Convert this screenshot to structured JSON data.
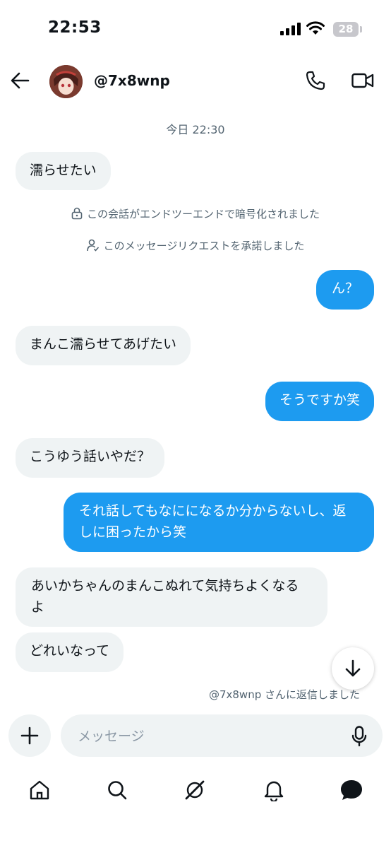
{
  "status_bar": {
    "time": "22:53",
    "battery": "28"
  },
  "header": {
    "username": "@7x8wnp",
    "back_icon": "arrow-left-icon",
    "call_icon": "phone-icon",
    "video_icon": "video-icon"
  },
  "chat": {
    "timestamp": "今日 22:30",
    "first_message": "濡らせたい",
    "encryption_notice": "この会話がエンドツーエンドで暗号化されました",
    "request_notice": "このメッセージリクエストを承諾しました",
    "messages": [
      {
        "side": "out",
        "text": "ん？"
      },
      {
        "side": "in",
        "text": "まんこ濡らせてあげたい"
      },
      {
        "side": "out",
        "text": "そうですか笑"
      },
      {
        "side": "in",
        "text": "こうゆう話いやだ？"
      },
      {
        "side": "out",
        "text": "それ話してもなにになるか分からないし、返しに困ったから笑"
      },
      {
        "side": "in",
        "text": "あいかちゃんのまんこぬれて気持ちよくなるよ"
      },
      {
        "side": "in",
        "text": "どれいなって"
      }
    ],
    "reply_note": "@7x8wnp さんに返信しました"
  },
  "composer": {
    "placeholder": "メッセージ"
  },
  "tabbar": {
    "icons": [
      "home-icon",
      "search-icon",
      "grok-icon",
      "notifications-icon",
      "messages-icon"
    ]
  },
  "colors": {
    "accent": "#1d9bf0",
    "incoming_bubble": "#eff3f4",
    "muted_text": "#536471"
  }
}
